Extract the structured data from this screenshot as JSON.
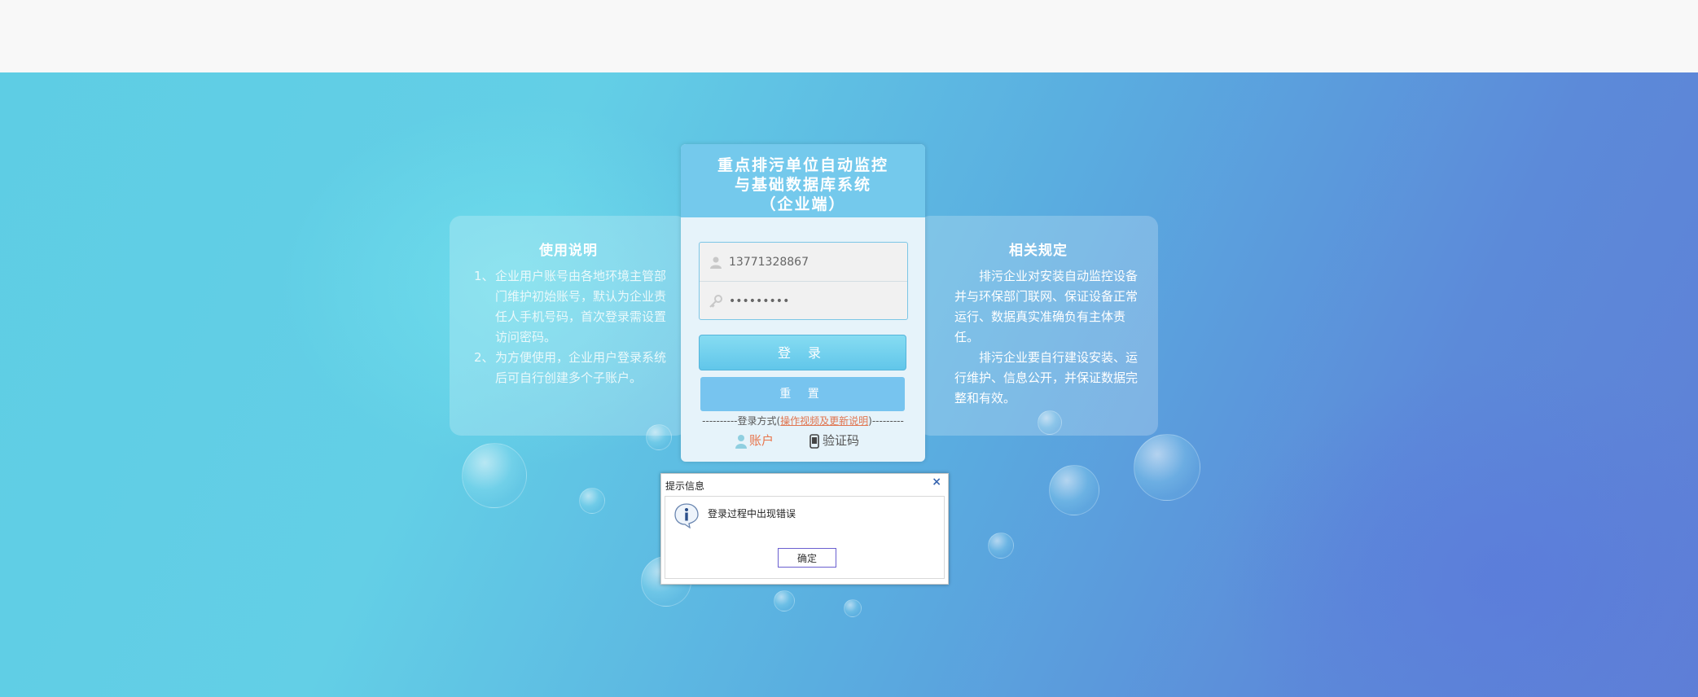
{
  "login": {
    "title": "重点排污单位自动监控\n与基础数据库系统\n（企业端）",
    "username_value": "13771328867",
    "password_value": "•••••••••",
    "login_button": "登 录",
    "reset_button": "重 置",
    "method_prefix": "----------登录方式(",
    "method_link": "操作视频及更新说明",
    "method_suffix": ")---------",
    "mode_account": "账户",
    "mode_code": "验证码"
  },
  "usage": {
    "title": "使用说明",
    "items": [
      {
        "num": "1、",
        "text": "企业用户账号由各地环境主管部门维护初始账号，默认为企业责任人手机号码，首次登录需设置访问密码。"
      },
      {
        "num": "2、",
        "text": "为方便使用，企业用户登录系统后可自行创建多个子账户。"
      }
    ]
  },
  "rules": {
    "title": "相关规定",
    "paragraphs": [
      "排污企业对安装自动监控设备并与环保部门联网、保证设备正常运行、数据真实准确负有主体责任。",
      "排污企业要自行建设安装、运行维护、信息公开，并保证数据完整和有效。"
    ]
  },
  "dialog": {
    "title": "提示信息",
    "close": "×",
    "message": "登录过程中出现错误",
    "ok": "确定"
  },
  "icons": {
    "user": "user-icon",
    "password": "key-icon",
    "account_mode": "person-icon",
    "code_mode": "phone-icon",
    "info": "info-icon"
  },
  "colors": {
    "header": "#74c9ec",
    "button": "#61c6ea",
    "link": "#e07550",
    "dialog_button_border": "#6a5fcf"
  }
}
